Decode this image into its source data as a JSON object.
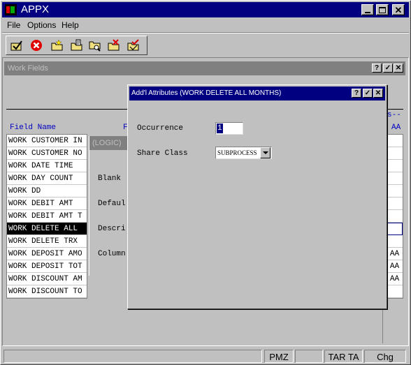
{
  "app": {
    "title": "APPX"
  },
  "menu": [
    "File",
    "Options",
    "Help"
  ],
  "toolbar": {
    "icons": [
      "check-icon",
      "cancel-icon",
      "folder-new-icon",
      "folder-edit-icon",
      "folder-search-icon",
      "folder-delete-icon",
      "folder-check-icon"
    ]
  },
  "work_fields": {
    "title": "Work Fields",
    "col_field_name": "Field Name",
    "col_f": "F",
    "col_right_header": "s--",
    "col_aa": "AA",
    "rows": [
      {
        "name": "WORK CUSTOMER IN",
        "aa": ""
      },
      {
        "name": "WORK CUSTOMER NO",
        "aa": ""
      },
      {
        "name": "WORK DATE TIME",
        "aa": ""
      },
      {
        "name": "WORK DAY COUNT",
        "aa": ""
      },
      {
        "name": "WORK DD",
        "aa": ""
      },
      {
        "name": "WORK DEBIT AMT",
        "aa": ""
      },
      {
        "name": "WORK DEBIT AMT T",
        "aa": ""
      },
      {
        "name": "WORK DELETE ALL",
        "aa": ""
      },
      {
        "name": "WORK DELETE TRX",
        "aa": ""
      },
      {
        "name": "WORK DEPOSIT AMO",
        "aa": "AA"
      },
      {
        "name": "WORK DEPOSIT TOT",
        "aa": "AA"
      },
      {
        "name": "WORK DISCOUNT AM",
        "aa": "AA"
      },
      {
        "name": "WORK DISCOUNT TO",
        "aa": ""
      }
    ],
    "selected_index": 7
  },
  "logic_panel": {
    "title": "(LOGIC)",
    "labels": [
      "Blank",
      "Defaul",
      "Descri",
      "Column"
    ]
  },
  "dialog": {
    "title": "Add'l Attributes (WORK DELETE ALL MONTHS)",
    "occurrence_label": "Occurrence",
    "occurrence_value": "1",
    "share_class_label": "Share Class",
    "share_class_value": "SUBPROCESS"
  },
  "status_bar": [
    "PMZ",
    "TAR TA",
    "Chg"
  ]
}
